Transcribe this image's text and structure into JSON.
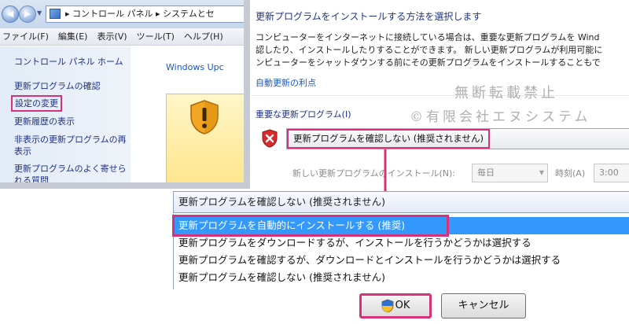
{
  "settings": {
    "title": "更新プログラムをインストールする方法を選択します",
    "description_lines": [
      "コンピューターをインターネットに接続している場合は、重要な更新プログラムを Wind",
      "認したり、インストールしたりすることができます。 新しい更新プログラムが利用可能に",
      "ンピューターをシャットダウンする前にその更新プログラムをインストールすることもで"
    ],
    "auto_update_link": "自動更新の利点",
    "important_section": "重要な更新プログラム(I)",
    "selected_option": "更新プログラムを確認しない (推奨されません)",
    "new_install_label": "新しい更新プログラムのインストール(N):",
    "frequency": "毎日",
    "time_label": "時刻(A)",
    "time_value": "3:00",
    "watermark_line1": "無断転載禁止",
    "watermark_line2": "©有限会社エヌシステム"
  },
  "explorer": {
    "address": "▸ コントロール パネル ▸ システムとセ",
    "menu": [
      "ファイル(F)",
      "編集(E)",
      "表示(V)",
      "ツール(T)",
      "ヘルプ(H)"
    ],
    "left_pane": {
      "home": "コントロール パネル ホーム",
      "check_updates": "更新プログラムの確認",
      "change_settings": "設定の変更",
      "history": "更新履歴の表示",
      "hidden_line1": "非表示の更新プログラムの再",
      "hidden_line2": "表示",
      "faq_line1": "更新プログラムのよく寄せら",
      "faq_line2": "れる質問"
    },
    "windows_update_label": "Windows Upc"
  },
  "dropdown": {
    "current": "更新プログラムを確認しない (推奨されません)",
    "options": [
      "更新プログラムを自動的にインストールする (推奨)",
      "更新プログラムをダウンロードするが、インストールを行うかどうかは選択する",
      "更新プログラムを確認するが、ダウンロードとインストールを行うかどうかは選択する",
      "更新プログラムを確認しない (推奨されません)"
    ],
    "highlighted_index": 0
  },
  "buttons": {
    "ok": "OK",
    "cancel": "キャンセル"
  },
  "colors": {
    "highlight_border": "#d4327a",
    "selection_blue": "#3399ff",
    "link_blue": "#1a55c8",
    "heading_blue": "#1e3287"
  }
}
